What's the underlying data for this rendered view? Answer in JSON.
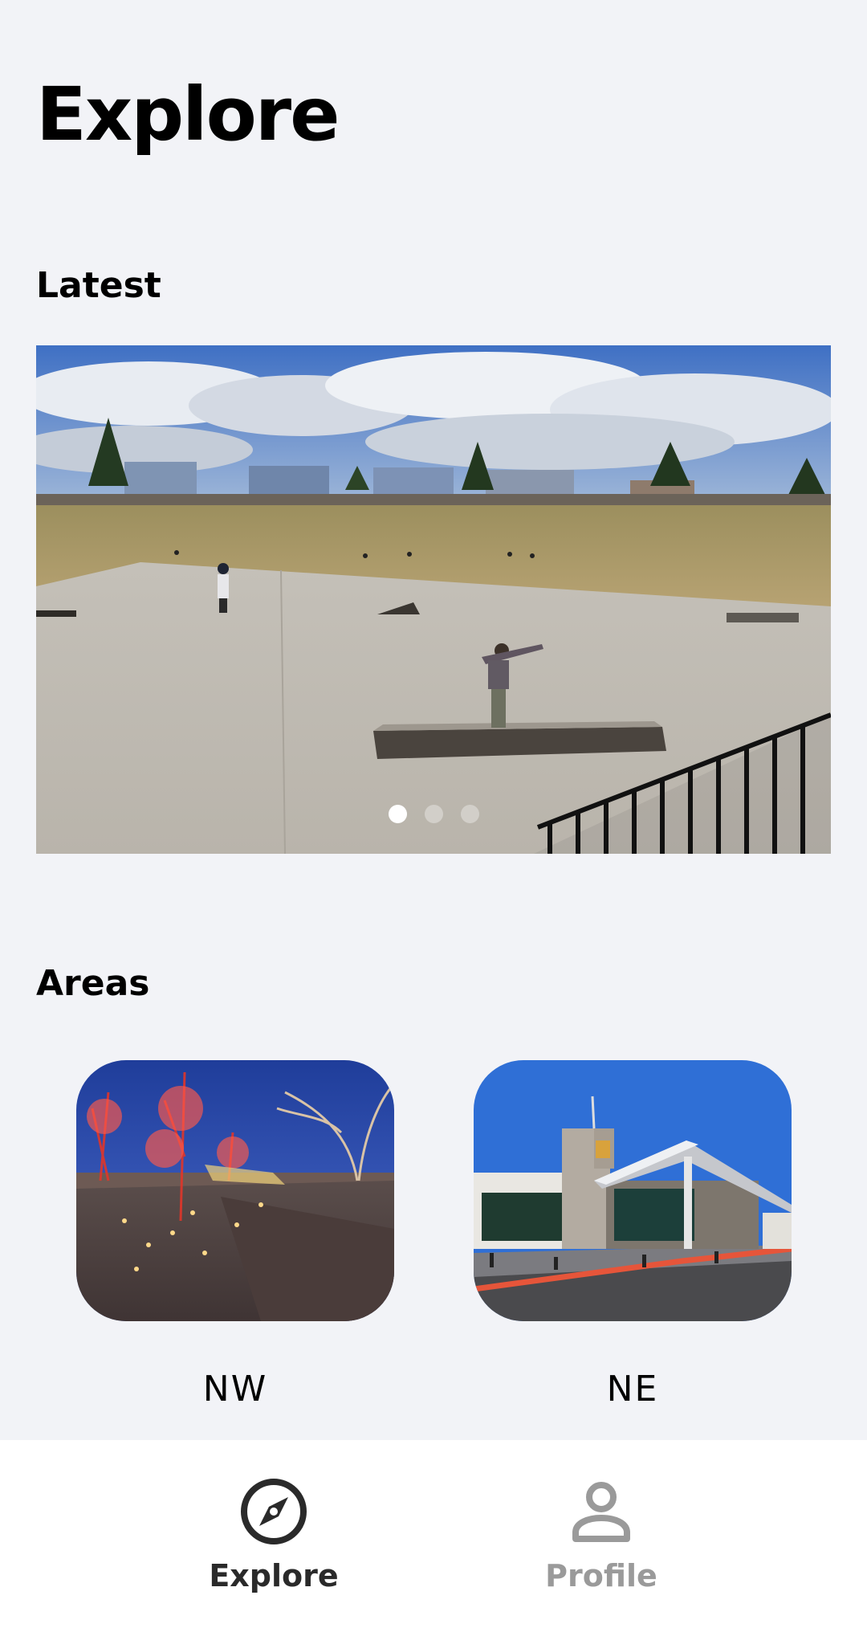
{
  "page": {
    "title": "Explore"
  },
  "latest": {
    "heading": "Latest",
    "carousel": {
      "slide_count": 3,
      "active_index": 0
    }
  },
  "areas": {
    "heading": "Areas",
    "items": [
      {
        "label": "NW"
      },
      {
        "label": "NE"
      }
    ]
  },
  "nav": {
    "items": [
      {
        "label": "Explore",
        "icon": "compass-icon",
        "active": true
      },
      {
        "label": "Profile",
        "icon": "person-icon",
        "active": false
      }
    ]
  },
  "colors": {
    "background": "#f2f3f7",
    "nav_background": "#ffffff",
    "nav_active": "#2a2a2a",
    "nav_inactive": "#9a9a9a"
  }
}
